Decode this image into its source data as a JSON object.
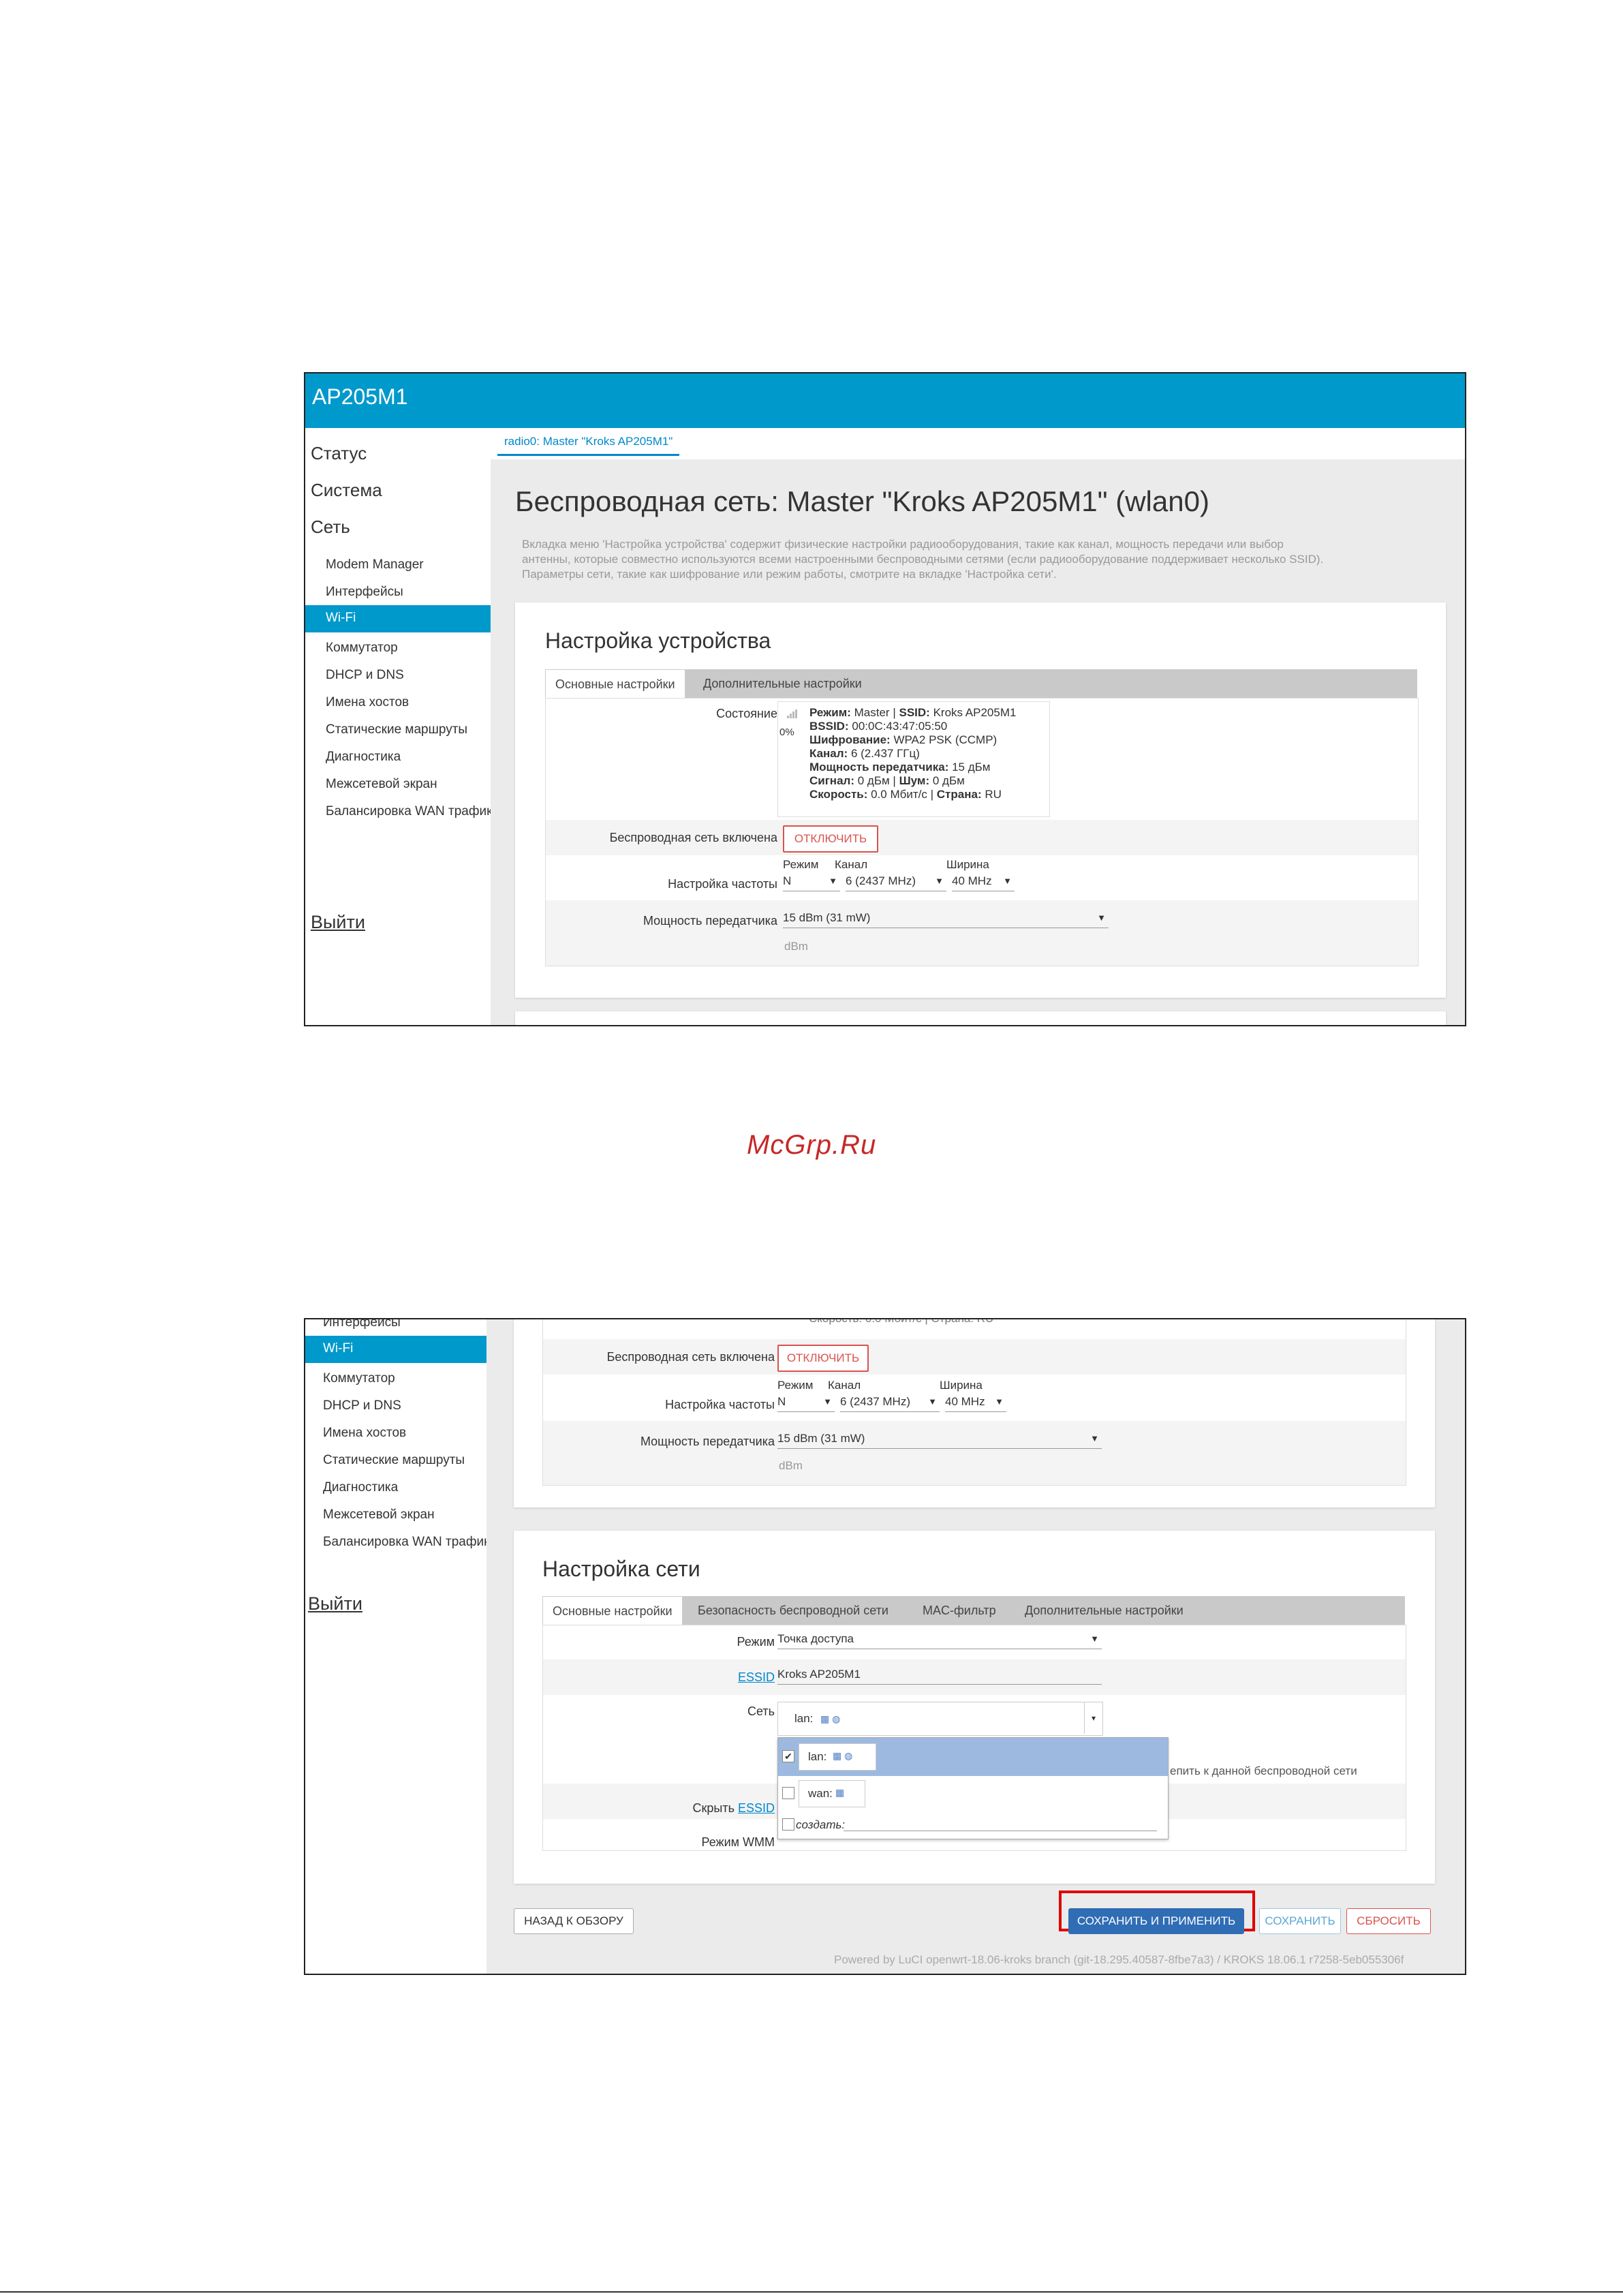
{
  "app_title": "AP205M1",
  "sidebar": {
    "items": [
      "Статус",
      "Система",
      "Сеть"
    ],
    "sub_items": [
      "Modem Manager",
      "Интерфейсы",
      "Wi-Fi",
      "Коммутатор",
      "DHCP и DNS",
      "Имена хостов",
      "Статические маршруты",
      "Диагностика",
      "Межсетевой экран",
      "Балансировка WAN трафик"
    ],
    "active": "Wi-Fi",
    "logout": "Выйти"
  },
  "page": {
    "radio_tab": "radio0: Master \"Kroks AP205M1\"",
    "title": "Беспроводная сеть: Master \"Kroks AP205M1\" (wlan0)",
    "desc_1": "Вкладка меню 'Настройка устройства' содержит физические настройки радиооборудования, такие как канал, мощность передачи или выбор",
    "desc_2": "антенны, которые совместно используются всеми настроенными беспроводными сетями (если радиооборудование поддерживает несколько SSID).",
    "desc_3": "Параметры сети, такие как шифрование или режим работы, смотрите на вкладке 'Настройка сети'."
  },
  "device": {
    "title": "Настройка устройства",
    "tabs": [
      "Основные настройки",
      "Дополнительные настройки"
    ],
    "status_label": "Состояние",
    "signal_pct": "0%",
    "status": {
      "mode_k": "Режим:",
      "mode_v": "Master",
      "ssid_k": "SSID:",
      "ssid_v": "Kroks AP205M1",
      "bssid_k": "BSSID:",
      "bssid_v": "00:0C:43:47:05:50",
      "enc_k": "Шифрование:",
      "enc_v": "WPA2 PSK (CCMP)",
      "chan_k": "Канал:",
      "chan_v": "6 (2.437 ГГц)",
      "power_k": "Мощность передатчика:",
      "power_v": "15 дБм",
      "sig_k": "Сигнал:",
      "sig_v": "0 дБм",
      "noise_k": "Шум:",
      "noise_v": "0 дБм",
      "speed_k": "Скорость:",
      "speed_v": "0.0 Мбит/с",
      "country_k": "Страна:",
      "country_v": "RU",
      "sep": "|"
    },
    "enabled_label": "Беспроводная сеть включена",
    "disable_btn": "ОТКЛЮЧИТЬ",
    "freq_label": "Настройка частоты",
    "mode_col": "Режим",
    "mode_val": "N",
    "chan_col": "Канал",
    "chan_val": "6 (2437 MHz)",
    "width_col": "Ширина",
    "width_val": "40 MHz",
    "power_label": "Мощность передатчика",
    "power_val": "15 dBm (31 mW)",
    "power_hint": "dBm",
    "partial_line": "Скорость: 0.0 Мбит/с | Страна: RU"
  },
  "network": {
    "title": "Настройка сети",
    "tabs": [
      "Основные настройки",
      "Безопасность беспроводной сети",
      "MAC-фильтр",
      "Дополнительные настройки"
    ],
    "mode_label": "Режим",
    "mode_val": "Точка доступа",
    "essid_label": "ESSID",
    "essid_val": "Kroks AP205M1",
    "net_label": "Сеть",
    "net_val": "lan:",
    "net_hint": "епить к данной беспроводной сети",
    "dropdown": [
      "lan:",
      "wan:",
      "создать:"
    ],
    "hide_label": "Скрыть",
    "hide_link": "ESSID",
    "wmm_label": "Режим WMM"
  },
  "actions": {
    "back": "НАЗАД К ОБЗОРУ",
    "save_apply": "СОХРАНИТЬ И ПРИМЕНИТЬ",
    "save": "СОХРАНИТЬ",
    "reset": "СБРОСИТЬ"
  },
  "footer": "Powered by LuCI openwrt-18.06-kroks branch (git-18.295.40587-8fbe7a3) / KROKS 18.06.1 r7258-5eb055306f",
  "watermark": "McGrp.Ru",
  "colors": {
    "accent": "#0099cc",
    "danger": "#d9534f",
    "primary": "#2f6db5",
    "highlight": "#e00000"
  }
}
